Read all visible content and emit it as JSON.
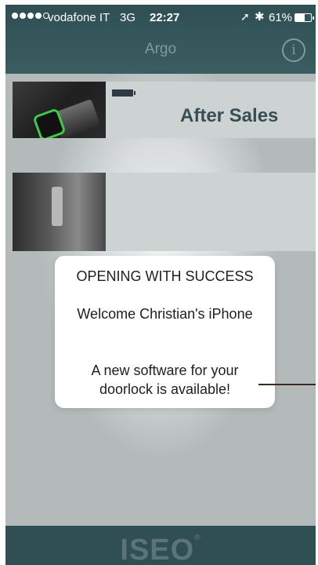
{
  "status_bar": {
    "carrier": "vodafone IT",
    "network": "3G",
    "time": "22:27",
    "location_icon": "➚",
    "bluetooth_icon": "✱",
    "battery_percent": "61%",
    "battery_level": 0.61
  },
  "nav": {
    "title": "Argo",
    "info_label": "i"
  },
  "cards": [
    {
      "title": "After Sales",
      "battery_icon": "battery-icon"
    },
    {
      "title": ""
    }
  ],
  "alert": {
    "title": "OPENING WITH SUCCESS",
    "message_1": "Welcome Christian's iPhone",
    "message_2": "A new software for your doorlock is available!"
  },
  "footer": {
    "logo_text": "ISEO"
  },
  "colors": {
    "bar": "#2f4f54",
    "nav_text": "#7f9aa0",
    "accent_green": "#3ec94a",
    "card_title": "#3a4d55"
  }
}
